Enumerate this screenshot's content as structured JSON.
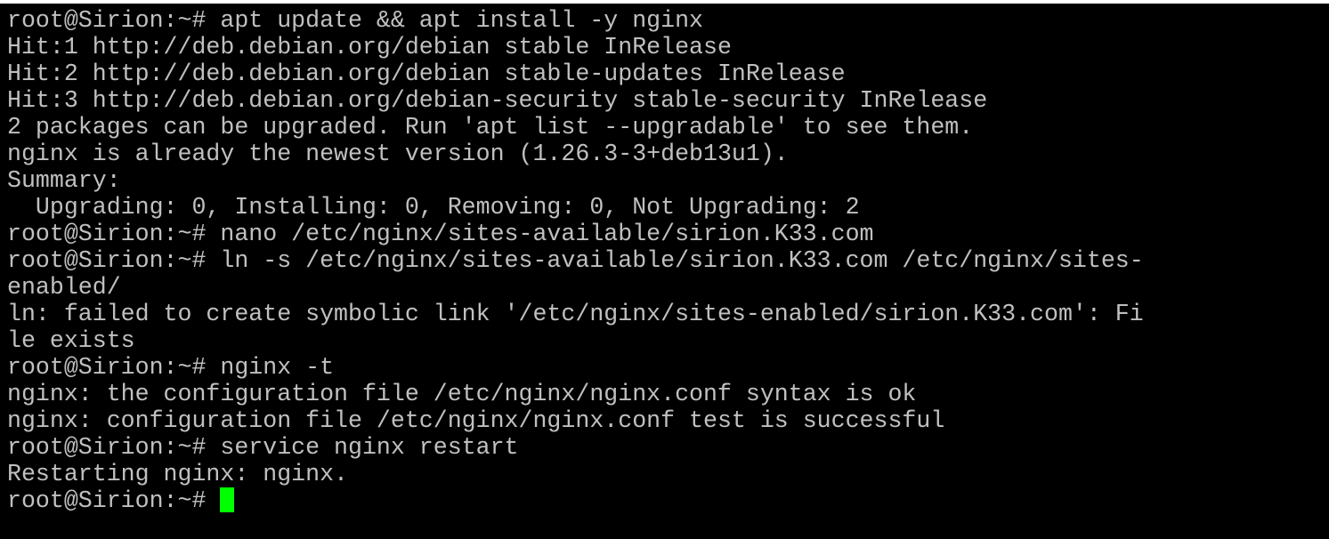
{
  "terminal": {
    "cursor_color": "#00ff00",
    "text_color": "#c0c0c0",
    "background_color": "#000000",
    "lines": [
      "root@Sirion:~# apt update && apt install -y nginx",
      "Hit:1 http://deb.debian.org/debian stable InRelease",
      "Hit:2 http://deb.debian.org/debian stable-updates InRelease",
      "Hit:3 http://deb.debian.org/debian-security stable-security InRelease",
      "2 packages can be upgraded. Run 'apt list --upgradable' to see them.",
      "nginx is already the newest version (1.26.3-3+deb13u1).",
      "Summary:",
      "  Upgrading: 0, Installing: 0, Removing: 0, Not Upgrading: 2",
      "root@Sirion:~# nano /etc/nginx/sites-available/sirion.K33.com",
      "root@Sirion:~# ln -s /etc/nginx/sites-available/sirion.K33.com /etc/nginx/sites-",
      "enabled/",
      "ln: failed to create symbolic link '/etc/nginx/sites-enabled/sirion.K33.com': Fi",
      "le exists",
      "root@Sirion:~# nginx -t",
      "nginx: the configuration file /etc/nginx/nginx.conf syntax is ok",
      "nginx: configuration file /etc/nginx/nginx.conf test is successful",
      "root@Sirion:~# service nginx restart",
      "Restarting nginx: nginx."
    ],
    "prompt": "root@Sirion:~# "
  }
}
